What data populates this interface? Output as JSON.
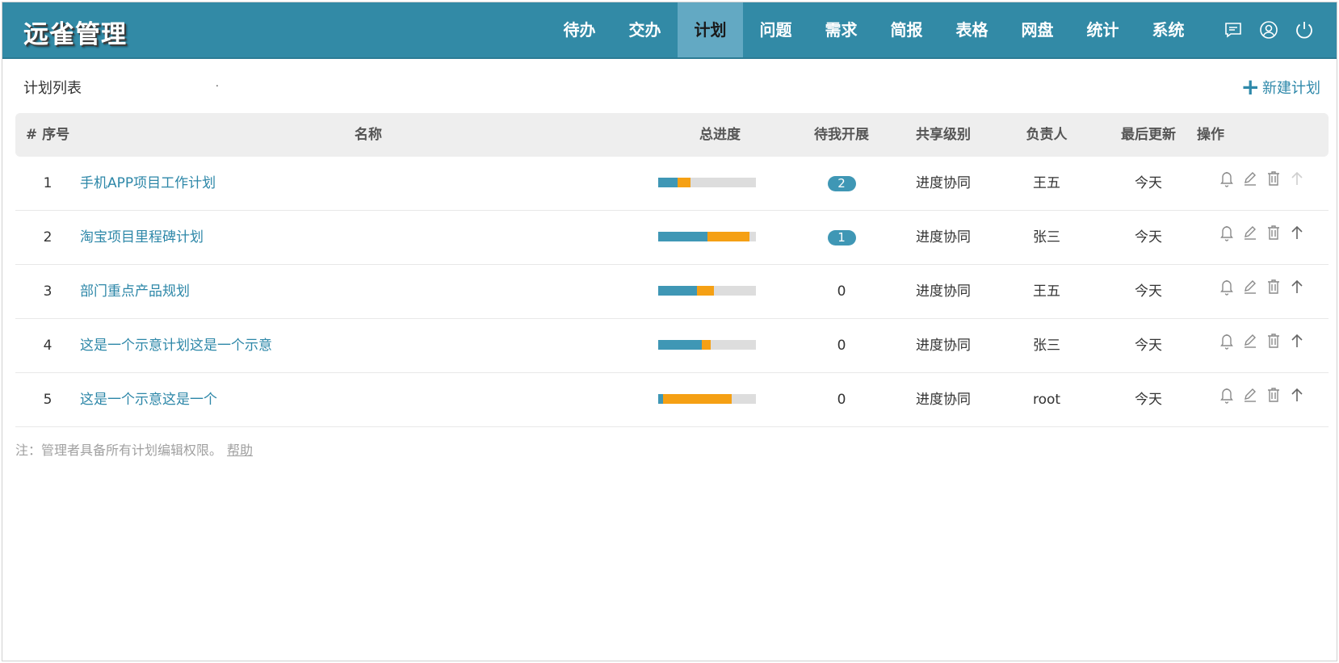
{
  "app": {
    "logo": "远雀管理"
  },
  "nav": [
    {
      "label": "待办"
    },
    {
      "label": "交办"
    },
    {
      "label": "计划",
      "active": true
    },
    {
      "label": "问题"
    },
    {
      "label": "需求"
    },
    {
      "label": "简报"
    },
    {
      "label": "表格"
    },
    {
      "label": "网盘"
    },
    {
      "label": "统计"
    },
    {
      "label": "系统"
    }
  ],
  "toolbar_icons": [
    "message-icon",
    "user-icon",
    "power-icon"
  ],
  "page": {
    "title": "计划列表",
    "dot": ".",
    "new_label": "新建计划",
    "new_icon": "plus-icon"
  },
  "table": {
    "headers": {
      "num": "# 序号",
      "name": "名称",
      "progress": "总进度",
      "pending": "待我开展",
      "share": "共享级别",
      "owner": "负责人",
      "updated": "最后更新",
      "ops": "操作"
    },
    "rows": [
      {
        "num": "1",
        "name": "手机APP项目工作计划",
        "progress_done": 0.2,
        "progress_active": 0.13,
        "pending": "2",
        "pending_badge": true,
        "share": "进度协同",
        "owner": "王五",
        "updated": "今天",
        "up_enabled": false
      },
      {
        "num": "2",
        "name": "淘宝项目里程碑计划",
        "progress_done": 0.5,
        "progress_active": 0.43,
        "pending": "1",
        "pending_badge": true,
        "share": "进度协同",
        "owner": "张三",
        "updated": "今天",
        "up_enabled": true
      },
      {
        "num": "3",
        "name": "部门重点产品规划",
        "progress_done": 0.4,
        "progress_active": 0.17,
        "pending": "0",
        "pending_badge": false,
        "share": "进度协同",
        "owner": "王五",
        "updated": "今天",
        "up_enabled": true
      },
      {
        "num": "4",
        "name": "这是一个示意计划这是一个示意",
        "progress_done": 0.45,
        "progress_active": 0.09,
        "pending": "0",
        "pending_badge": false,
        "share": "进度协同",
        "owner": "张三",
        "updated": "今天",
        "up_enabled": true
      },
      {
        "num": "5",
        "name": "这是一个示意这是一个",
        "progress_done": 0.05,
        "progress_active": 0.7,
        "pending": "0",
        "pending_badge": false,
        "share": "进度协同",
        "owner": "root",
        "updated": "今天",
        "up_enabled": true
      }
    ],
    "row_icons": [
      "bell-icon",
      "edit-icon",
      "trash-icon",
      "arrow-up-icon"
    ]
  },
  "note": {
    "text": "注：管理者具备所有计划编辑权限。",
    "link": "帮助"
  },
  "colors": {
    "header": "#328aa6",
    "active_tab": "#63a9c3",
    "done": "#3f97b5",
    "active": "#f5a014",
    "track": "#dddddd",
    "link": "#2d87a8"
  }
}
